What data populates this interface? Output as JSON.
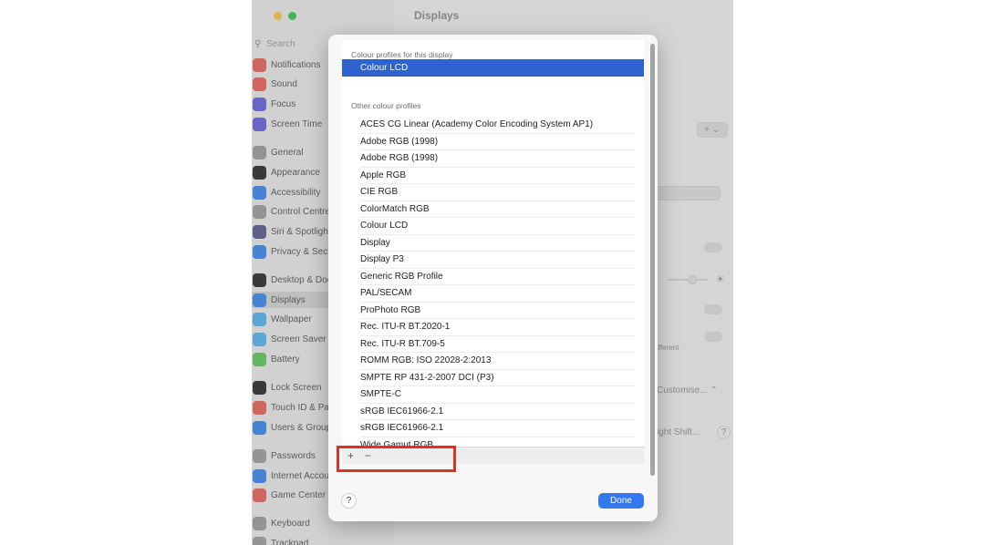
{
  "window": {
    "title": "Displays",
    "traffic_lights": [
      "#ff5f57",
      "#febc2e",
      "#28c840"
    ],
    "search_placeholder": "Search",
    "search_icon": "magnifier-icon"
  },
  "sidebar": {
    "items": [
      {
        "label": "Notifications",
        "icon": "bell-icon",
        "color": "#e2625a"
      },
      {
        "label": "Sound",
        "icon": "speaker-icon",
        "color": "#e2625a"
      },
      {
        "label": "Focus",
        "icon": "moon-icon",
        "color": "#6462d6"
      },
      {
        "label": "Screen Time",
        "icon": "hourglass-icon",
        "color": "#6462d6"
      },
      {
        "label": "General",
        "icon": "gear-icon",
        "color": "#9a9a9a"
      },
      {
        "label": "Appearance",
        "icon": "appearance-icon",
        "color": "#2c2c2c"
      },
      {
        "label": "Accessibility",
        "icon": "accessibility-icon",
        "color": "#3c86e8"
      },
      {
        "label": "Control Centre",
        "icon": "control-centre-icon",
        "color": "#9a9a9a"
      },
      {
        "label": "Siri & Spotlight",
        "icon": "siri-icon",
        "color": "#5a5a8a"
      },
      {
        "label": "Privacy & Security",
        "icon": "hand-icon",
        "color": "#3c86e8"
      },
      {
        "label": "Desktop & Dock",
        "icon": "dock-icon",
        "color": "#2c2c2c"
      },
      {
        "label": "Displays",
        "icon": "sun-icon",
        "color": "#3c86e8"
      },
      {
        "label": "Wallpaper",
        "icon": "wallpaper-icon",
        "color": "#55b0e8"
      },
      {
        "label": "Screen Saver",
        "icon": "screensaver-icon",
        "color": "#55b0e8"
      },
      {
        "label": "Battery",
        "icon": "battery-icon",
        "color": "#5ec25e"
      },
      {
        "label": "Lock Screen",
        "icon": "lock-icon",
        "color": "#2c2c2c"
      },
      {
        "label": "Touch ID & Password",
        "icon": "fingerprint-icon",
        "color": "#e2625a"
      },
      {
        "label": "Users & Groups",
        "icon": "users-icon",
        "color": "#3c86e8"
      },
      {
        "label": "Passwords",
        "icon": "key-icon",
        "color": "#9a9a9a"
      },
      {
        "label": "Internet Accounts",
        "icon": "at-icon",
        "color": "#3c86e8"
      },
      {
        "label": "Game Center",
        "icon": "game-center-icon",
        "color": "#e2625a"
      },
      {
        "label": "Keyboard",
        "icon": "keyboard-icon",
        "color": "#9a9a9a"
      },
      {
        "label": "Trackpad",
        "icon": "trackpad-icon",
        "color": "#9a9a9a"
      }
    ],
    "selected": "Displays"
  },
  "background_controls": {
    "add_menu": "+ ⌄",
    "different_text": "ifferent",
    "customise_label": "Customise...",
    "night_shift_label": "ight Shift...",
    "help": "?"
  },
  "sheet": {
    "section_this_display": "Colour profiles for this display",
    "selected_profile": "Colour LCD",
    "section_other": "Other colour profiles",
    "profiles": [
      "ACES CG Linear (Academy Color Encoding System AP1)",
      "Adobe RGB (1998)",
      "Adobe RGB (1998)",
      "Apple RGB",
      "CIE RGB",
      "ColorMatch RGB",
      "Colour LCD",
      "Display",
      "Display P3",
      "Generic RGB Profile",
      "PAL/SECAM",
      "ProPhoto RGB",
      "Rec. ITU-R BT.2020-1",
      "Rec. ITU-R BT.709-5",
      "ROMM RGB: ISO 22028-2:2013",
      "SMPTE RP 431-2-2007 DCI (P3)",
      "SMPTE-C",
      "sRGB IEC61966-2.1",
      "sRGB IEC61966-2.1",
      "Wide Gamut RGB"
    ],
    "add_label": "+",
    "remove_label": "−",
    "help_label": "?",
    "done_label": "Done",
    "highlight_color": "#e2301f"
  }
}
